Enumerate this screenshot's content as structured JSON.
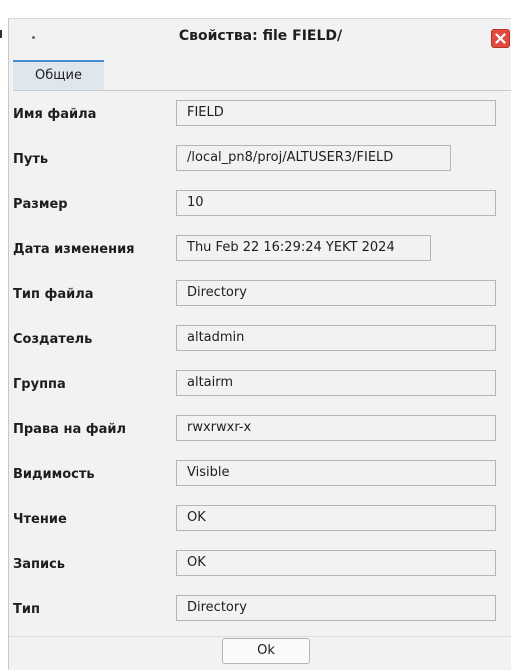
{
  "window": {
    "title": "Свойства: file FIELD/"
  },
  "tabs": [
    {
      "label": "Общие",
      "active": true
    }
  ],
  "properties": [
    {
      "label": "Имя файла",
      "value": "FIELD"
    },
    {
      "label": "Путь",
      "value": "/local_pn8/proj/ALTUSER3/FIELD"
    },
    {
      "label": "Размер",
      "value": "10"
    },
    {
      "label": "Дата изменения",
      "value": "Thu Feb 22 16:29:24 YEKT 2024"
    },
    {
      "label": "Тип файла",
      "value": "Directory"
    },
    {
      "label": "Создатель",
      "value": "altadmin"
    },
    {
      "label": "Группа",
      "value": "altairm"
    },
    {
      "label": "Права на файл",
      "value": "rwxrwxr-x"
    },
    {
      "label": "Видимость",
      "value": "Visible"
    },
    {
      "label": "Чтение",
      "value": "OK"
    },
    {
      "label": "Запись",
      "value": "OK"
    },
    {
      "label": "Тип",
      "value": "Directory"
    }
  ],
  "footer": {
    "ok_label": "Ok"
  },
  "colors": {
    "close_button": "#e04a3f",
    "tab_accent": "#4a8bd1",
    "tab_background": "#dfe7ee",
    "window_background": "#f2f2f2"
  }
}
